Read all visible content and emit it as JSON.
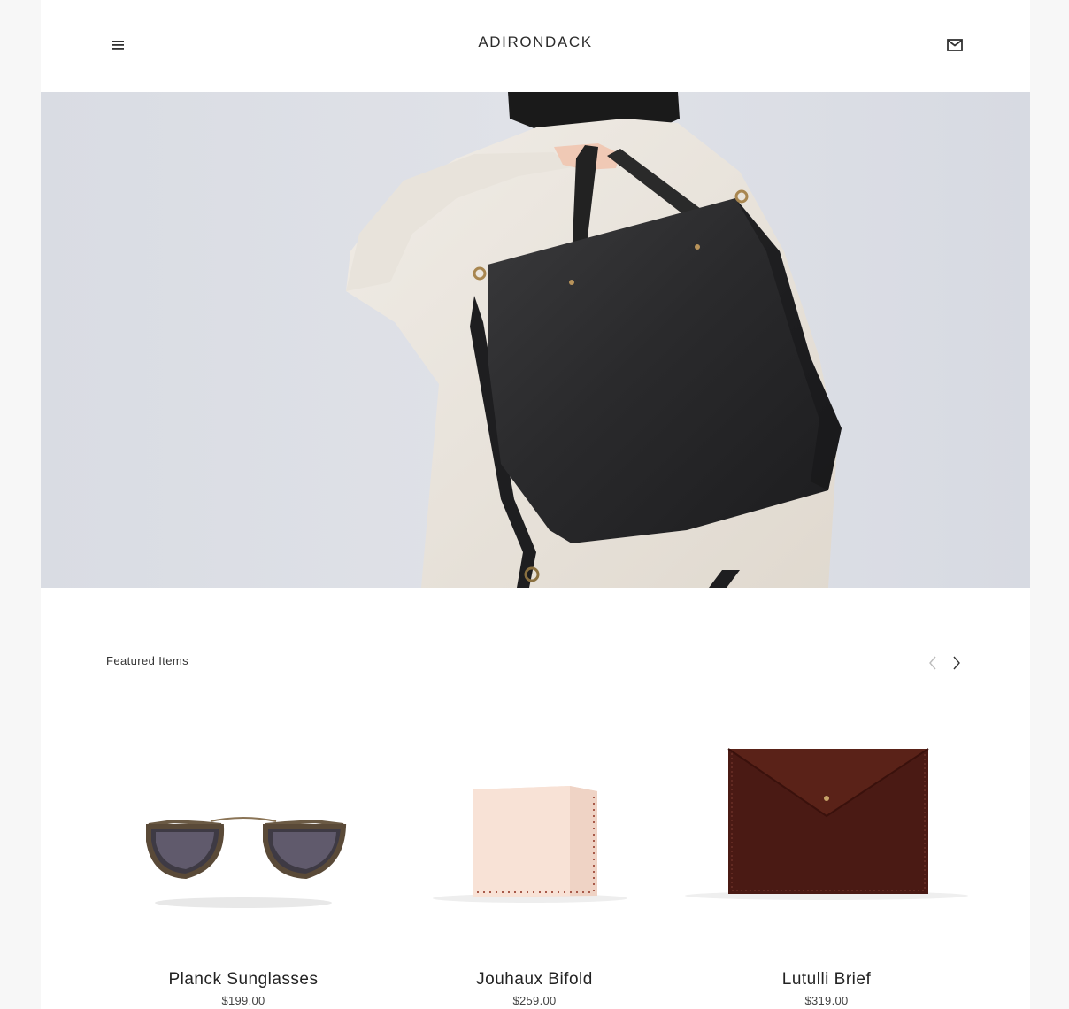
{
  "header": {
    "brand": "ADIRONDACK",
    "menu_icon": "hamburger-menu-icon",
    "mail_icon": "envelope-icon"
  },
  "hero": {
    "image_subject": "person carrying black leather tote bag"
  },
  "featured": {
    "label": "Featured Items",
    "prev_icon": "chevron-left-icon",
    "next_icon": "chevron-right-icon",
    "products": [
      {
        "name": "Planck Sunglasses",
        "price": "$199.00"
      },
      {
        "name": "Jouhaux Bifold",
        "price": "$259.00"
      },
      {
        "name": "Lutulli Brief",
        "price": "$319.00"
      }
    ]
  },
  "colors": {
    "text": "#222222",
    "hero_background": "#dde0e6",
    "arrow_disabled": "#bbbbbb"
  }
}
